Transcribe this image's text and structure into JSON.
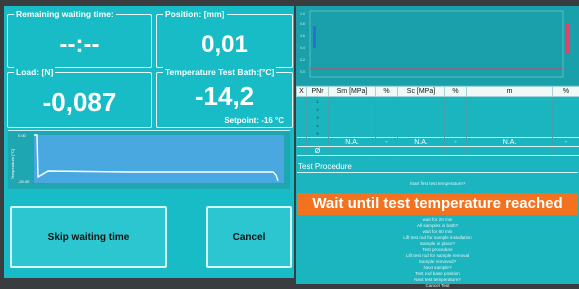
{
  "status": {
    "remaining_label": "Remaining waiting time:",
    "remaining_value": "--:--",
    "position_label": "Position: [mm]",
    "position_value": "0,01",
    "load_label": "Load: [N]",
    "load_value": "-0,087",
    "temp_label": "Temperature Test Bath:[°C]",
    "temp_value": "-14,2",
    "setpoint": "Setpoint: -16 °C"
  },
  "trend": {
    "y_label": "Temperature [°C]",
    "y_top": "0.00",
    "y_bottom": "-20.00"
  },
  "buttons": {
    "skip": "Skip waiting time",
    "cancel": "Cancel"
  },
  "table": {
    "headers": [
      "X",
      "PNr",
      "Sm [MPa]",
      "%",
      "Sc [MPa]",
      "%",
      "m",
      "%"
    ],
    "rows": [
      [
        "",
        "1",
        "",
        "",
        "",
        "",
        "",
        ""
      ],
      [
        "",
        "2",
        "",
        "",
        "",
        "",
        "",
        ""
      ],
      [
        "",
        "3",
        "",
        "",
        "",
        "",
        "",
        ""
      ],
      [
        "",
        "4",
        "",
        "",
        "",
        "",
        "",
        ""
      ],
      [
        "",
        "5",
        "",
        "",
        "",
        "",
        "",
        ""
      ]
    ],
    "summary": [
      "",
      "",
      "N.A.",
      "-",
      "N.A.",
      "-",
      "N.A.",
      "-"
    ],
    "summary2": [
      "",
      "Ø",
      "",
      "",
      "",
      "",
      "",
      ""
    ]
  },
  "procedure": {
    "title": "Test Procedure",
    "first": "Start first test temperature?",
    "active": "Wait until test temperature reached",
    "steps": [
      "wait for 20 min",
      "All samples in bath?",
      "wait for 60 min",
      "Lift test rod for sample installation",
      "Sample in place?",
      "Test procedure",
      "Lift test rod for sample removal",
      "Sample removed?",
      "Next sample?",
      "Test rod base position",
      "Next test temperature?",
      "Cancel Test"
    ]
  },
  "colors": {
    "panel": "#17bcc6",
    "highlight": "#f27220",
    "line": "#ffffff"
  }
}
